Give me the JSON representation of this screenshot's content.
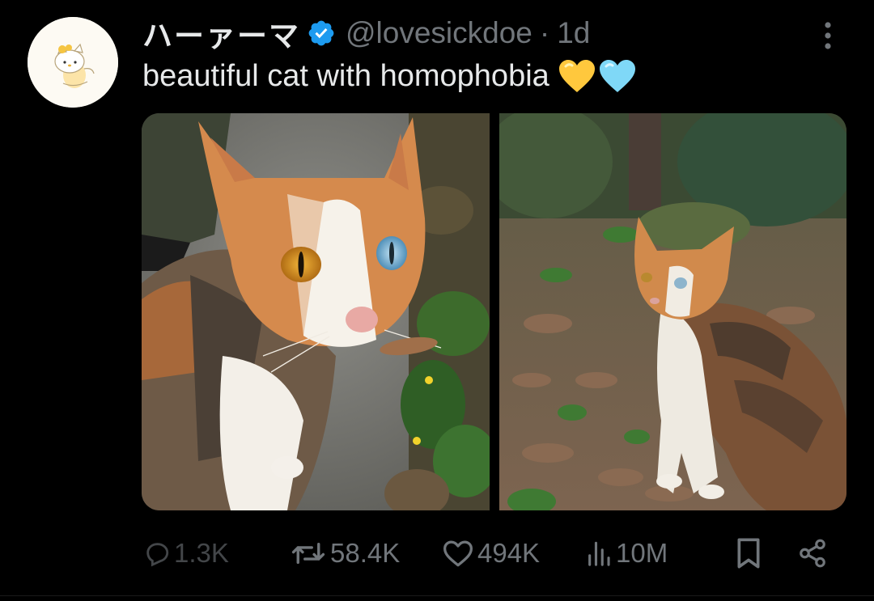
{
  "author": {
    "display_name": "ハーァーマ",
    "handle": "@lovesickdoe",
    "separator": "·",
    "age": "1d",
    "avatar_icon": "hello-kitty-avatar",
    "verified_icon": "verified-badge-icon"
  },
  "tweet": {
    "text": "beautiful cat with homophobia",
    "emoji": [
      "yellow-heart",
      "light-blue-heart"
    ]
  },
  "media": {
    "photos": [
      {
        "icon": "cat-closeup-photo"
      },
      {
        "icon": "cat-garden-photo"
      }
    ]
  },
  "actions": {
    "reply_count": "1.3K",
    "retweet_count": "58.4K",
    "like_count": "494K",
    "view_count": "10M"
  },
  "colors": {
    "background": "#000000",
    "text_primary": "#e7e9ea",
    "text_secondary": "#71767b",
    "verified_blue": "#1d9bf0",
    "heart_yellow": "#ffc83d",
    "heart_blue": "#7fd8f7"
  }
}
